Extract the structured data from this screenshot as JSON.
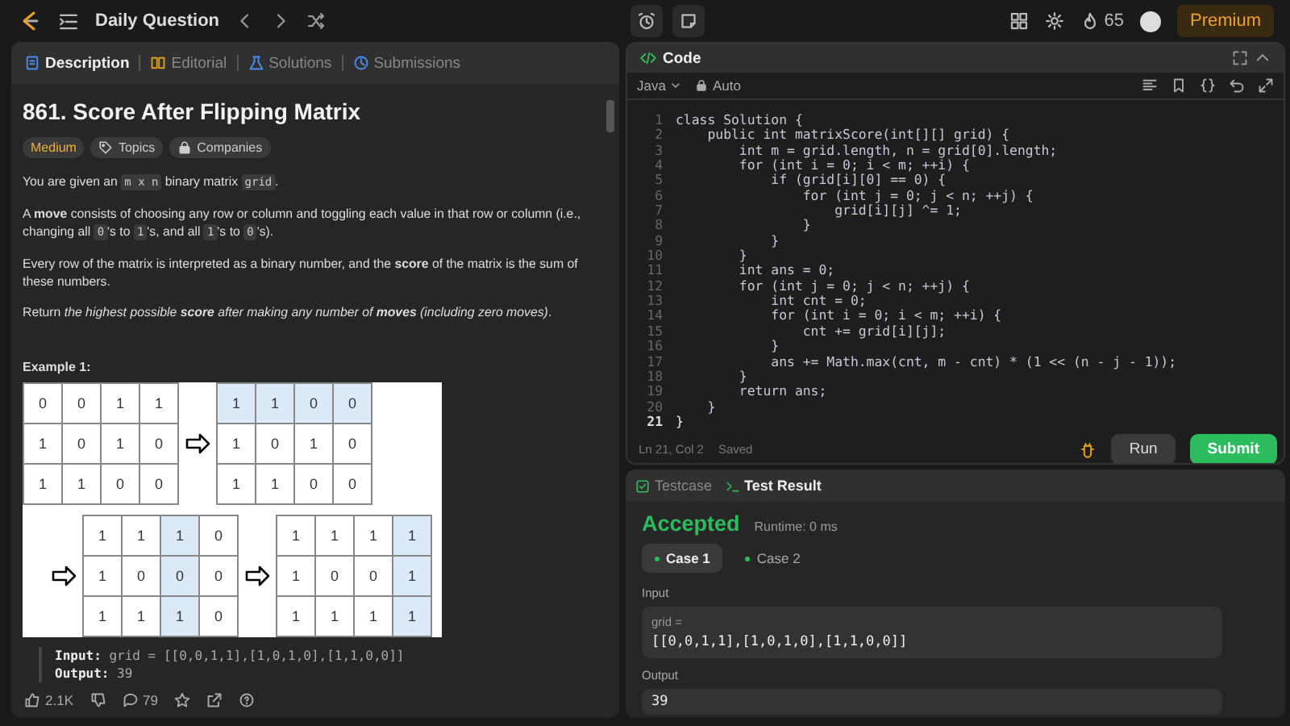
{
  "topbar": {
    "title": "Daily Question",
    "streak": "65",
    "premium": "Premium"
  },
  "description_panel": {
    "tabs": [
      {
        "label": "Description",
        "selected": true
      },
      {
        "label": "Editorial",
        "selected": false
      },
      {
        "label": "Solutions",
        "selected": false
      },
      {
        "label": "Submissions",
        "selected": false
      }
    ],
    "title": "861. Score After Flipping Matrix",
    "tags": [
      {
        "kind": "difficulty",
        "label": "Medium"
      },
      {
        "kind": "topics",
        "label": "Topics"
      },
      {
        "kind": "companies",
        "label": "Companies"
      }
    ],
    "paragraphs": [
      [
        {
          "kind": "text",
          "t": "You are given an "
        },
        {
          "kind": "code",
          "t": "m x n"
        },
        {
          "kind": "text",
          "t": " binary matrix "
        },
        {
          "kind": "code",
          "t": "grid"
        },
        {
          "kind": "text",
          "t": "."
        }
      ],
      [
        {
          "kind": "text",
          "t": "A **move** consists of choosing any row or column and toggling each value in that row or column (i.e., changing all "
        },
        {
          "kind": "code",
          "t": "0"
        },
        {
          "kind": "text",
          "t": "'s to "
        },
        {
          "kind": "code",
          "t": "1"
        },
        {
          "kind": "text",
          "t": "'s, and all "
        },
        {
          "kind": "code",
          "t": "1"
        },
        {
          "kind": "text",
          "t": "'s to "
        },
        {
          "kind": "code",
          "t": "0"
        },
        {
          "kind": "text",
          "t": "'s)."
        }
      ],
      [
        {
          "kind": "text",
          "t": "Every row of the matrix is interpreted as a binary number, and the **score** of the matrix is the sum of these numbers."
        }
      ],
      [
        {
          "kind": "text",
          "t": "Return "
        },
        {
          "kind": "em",
          "t": "the highest possible **score** after making any number of **moves** (including zero moves)"
        },
        {
          "kind": "text",
          "t": "."
        }
      ]
    ],
    "example": {
      "heading": "Example 1:",
      "matrices": [
        {
          "rows": [
            [
              {
                "t": "0",
                "highlighted": false
              },
              {
                "t": "0",
                "highlighted": false
              },
              {
                "t": "1",
                "highlighted": false
              },
              {
                "t": "1",
                "highlighted": false
              }
            ],
            [
              {
                "t": "1",
                "highlighted": false
              },
              {
                "t": "0",
                "highlighted": false
              },
              {
                "t": "1",
                "highlighted": false
              },
              {
                "t": "0",
                "highlighted": false
              }
            ],
            [
              {
                "t": "1",
                "highlighted": false
              },
              {
                "t": "1",
                "highlighted": false
              },
              {
                "t": "0",
                "highlighted": false
              },
              {
                "t": "0",
                "highlighted": false
              }
            ]
          ]
        },
        {
          "rows": [
            [
              {
                "t": "1",
                "highlighted": true
              },
              {
                "t": "1",
                "highlighted": true
              },
              {
                "t": "0",
                "highlighted": true
              },
              {
                "t": "0",
                "highlighted": true
              }
            ],
            [
              {
                "t": "1",
                "highlighted": false
              },
              {
                "t": "0",
                "highlighted": false
              },
              {
                "t": "1",
                "highlighted": false
              },
              {
                "t": "0",
                "highlighted": false
              }
            ],
            [
              {
                "t": "1",
                "highlighted": false
              },
              {
                "t": "1",
                "highlighted": false
              },
              {
                "t": "0",
                "highlighted": false
              },
              {
                "t": "0",
                "highlighted": false
              }
            ]
          ]
        },
        {
          "rows": [
            [
              {
                "t": "1",
                "highlighted": false
              },
              {
                "t": "1",
                "highlighted": false
              },
              {
                "t": "1",
                "highlighted": true
              },
              {
                "t": "0",
                "highlighted": false
              }
            ],
            [
              {
                "t": "1",
                "highlighted": false
              },
              {
                "t": "0",
                "highlighted": false
              },
              {
                "t": "0",
                "highlighted": true
              },
              {
                "t": "0",
                "highlighted": false
              }
            ],
            [
              {
                "t": "1",
                "highlighted": false
              },
              {
                "t": "1",
                "highlighted": false
              },
              {
                "t": "1",
                "highlighted": true
              },
              {
                "t": "0",
                "highlighted": false
              }
            ]
          ]
        },
        {
          "rows": [
            [
              {
                "t": "1",
                "highlighted": false
              },
              {
                "t": "1",
                "highlighted": false
              },
              {
                "t": "1",
                "highlighted": false
              },
              {
                "t": "1",
                "highlighted": true
              }
            ],
            [
              {
                "t": "1",
                "highlighted": false
              },
              {
                "t": "0",
                "highlighted": false
              },
              {
                "t": "0",
                "highlighted": false
              },
              {
                "t": "1",
                "highlighted": true
              }
            ],
            [
              {
                "t": "1",
                "highlighted": false
              },
              {
                "t": "1",
                "highlighted": false
              },
              {
                "t": "1",
                "highlighted": false
              },
              {
                "t": "1",
                "highlighted": true
              }
            ]
          ]
        }
      ],
      "input_label": "Input:",
      "input": "grid = [[0,0,1,1],[1,0,1,0],[1,1,0,0]]",
      "output_label": "Output:",
      "output": "39"
    },
    "footer": {
      "likes": "2.1K",
      "comments": "79"
    }
  },
  "code_panel": {
    "title": "Code",
    "language": "Java",
    "mode": "Auto",
    "lines": [
      {
        "number": "1",
        "text": "class Solution {",
        "current": false
      },
      {
        "number": "2",
        "text": "    public int matrixScore(int[][] grid) {",
        "current": false
      },
      {
        "number": "3",
        "text": "        int m = grid.length, n = grid[0].length;",
        "current": false
      },
      {
        "number": "4",
        "text": "        for (int i = 0; i < m; ++i) {",
        "current": false
      },
      {
        "number": "5",
        "text": "            if (grid[i][0] == 0) {",
        "current": false
      },
      {
        "number": "6",
        "text": "                for (int j = 0; j < n; ++j) {",
        "current": false
      },
      {
        "number": "7",
        "text": "                    grid[i][j] ^= 1;",
        "current": false
      },
      {
        "number": "8",
        "text": "                }",
        "current": false
      },
      {
        "number": "9",
        "text": "            }",
        "current": false
      },
      {
        "number": "10",
        "text": "        }",
        "current": false
      },
      {
        "number": "11",
        "text": "        int ans = 0;",
        "current": false
      },
      {
        "number": "12",
        "text": "        for (int j = 0; j < n; ++j) {",
        "current": false
      },
      {
        "number": "13",
        "text": "            int cnt = 0;",
        "current": false
      },
      {
        "number": "14",
        "text": "            for (int i = 0; i < m; ++i) {",
        "current": false
      },
      {
        "number": "15",
        "text": "                cnt += grid[i][j];",
        "current": false
      },
      {
        "number": "16",
        "text": "            }",
        "current": false
      },
      {
        "number": "17",
        "text": "            ans += Math.max(cnt, m - cnt) * (1 << (n - j - 1));",
        "current": false
      },
      {
        "number": "18",
        "text": "        }",
        "current": false
      },
      {
        "number": "19",
        "text": "        return ans;",
        "current": false
      },
      {
        "number": "20",
        "text": "    }",
        "current": false
      },
      {
        "number": "21",
        "text": "}",
        "current": true
      }
    ],
    "cursor": "Ln 21, Col 2",
    "save_state": "Saved",
    "run": "Run",
    "submit": "Submit"
  },
  "result_panel": {
    "tabs": [
      {
        "label": "Testcase",
        "selected": false
      },
      {
        "label": "Test Result",
        "selected": true
      }
    ],
    "status": "Accepted",
    "runtime": "Runtime: 0 ms",
    "cases": [
      {
        "label": "Case 1",
        "selected": true
      },
      {
        "label": "Case 2",
        "selected": false
      }
    ],
    "input_label": "Input",
    "input_name": "grid =",
    "input_value": "[[0,0,1,1],[1,0,1,0],[1,1,0,0]]",
    "output_label": "Output",
    "output_value": "39"
  }
}
